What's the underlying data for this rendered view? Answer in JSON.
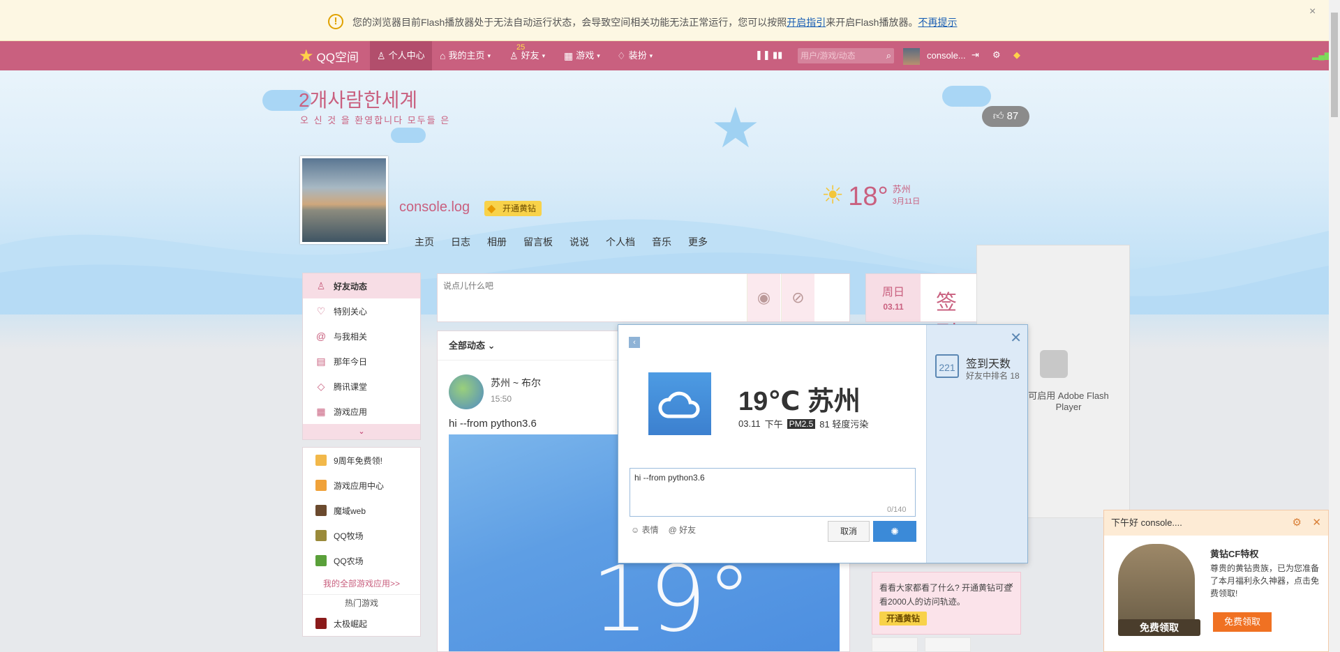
{
  "flash_notice": {
    "message": "您的浏览器目前Flash播放器处于无法自动运行状态，会导致空间相关功能无法正常运行，您可以按照",
    "link1": "开启指引",
    "mid": "来开启Flash播放器。",
    "link2": "不再提示",
    "close": "×"
  },
  "topnav": {
    "logo": "QQ空间",
    "tabs": [
      {
        "label": "个人中心"
      },
      {
        "label": "我的主页"
      },
      {
        "label": "好友"
      },
      {
        "label": "游戏"
      },
      {
        "label": "装扮"
      }
    ],
    "friend_badge": "25",
    "search_placeholder": "用户/游戏/动态",
    "username": "console..."
  },
  "header": {
    "title": "2개사람한세계",
    "subtitle": "오 신 것 을 환영합니다 모두들 은",
    "likes": "87",
    "username": "console.log",
    "vip_label": "开通黄钻",
    "weather_temp": "18°",
    "weather_city": "苏州",
    "weather_date": "3月11日"
  },
  "subnav": [
    "主页",
    "日志",
    "相册",
    "留言板",
    "说说",
    "个人档",
    "音乐",
    "更多"
  ],
  "left_menu": [
    {
      "label": "好友动态"
    },
    {
      "label": "特别关心"
    },
    {
      "label": "与我相关"
    },
    {
      "label": "那年今日"
    },
    {
      "label": "腾讯课堂"
    },
    {
      "label": "游戏应用"
    }
  ],
  "games": [
    {
      "label": "9周年免费领!",
      "color": "#f2b84a"
    },
    {
      "label": "游戏应用中心",
      "color": "#f0a23a"
    },
    {
      "label": "魔域web",
      "color": "#6b4a2e"
    },
    {
      "label": "QQ牧场",
      "color": "#9a8a3a"
    },
    {
      "label": "QQ农场",
      "color": "#5aa03a"
    }
  ],
  "all_games": "我的全部游戏应用>>",
  "hot_games": "热门游戏",
  "hot_first": "太极崛起",
  "composer": {
    "placeholder": "说点儿什么吧"
  },
  "feed": {
    "filter": "全部动态",
    "author": "苏州 ~ 布尔",
    "time": "15:50",
    "text": "hi --from python3.6",
    "image_temp": "19°"
  },
  "checkin": {
    "day": "周日",
    "date": "03.11",
    "sign": "签到"
  },
  "flash_placeholder": "可启用 Adobe Flash Player",
  "promo": {
    "text": "看看大家都看了什么? 开通黄钻可查看2000人的访问轨迹。",
    "button": "开通黄钻"
  },
  "modal": {
    "calendar_num": "221",
    "checkin_days": "签到天数",
    "rank": "好友中排名 18",
    "weather_title": "19℃ 苏州",
    "date": "03.11",
    "period": "下午",
    "pm_label": "PM2.5",
    "pm_value": "81 轻度污染",
    "text": "hi --from python3.6",
    "count": "0/140",
    "emoji": "表情",
    "friend": "好友",
    "cancel": "取消"
  },
  "popup": {
    "greeting": "下午好 console....",
    "title": "黄钻CF特权",
    "desc": "尊贵的黄钻贵族，已为您准备了本月福利永久神器，点击免费领取!",
    "button": "免费领取",
    "tag": "免费领取"
  }
}
